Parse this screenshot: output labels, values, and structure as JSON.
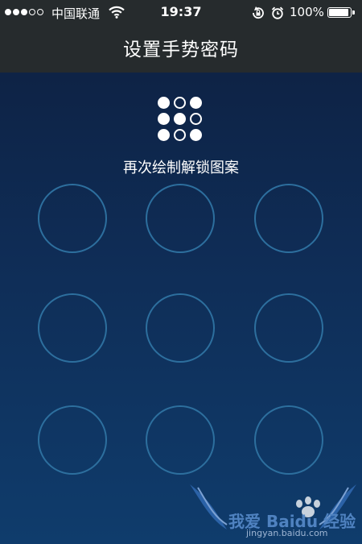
{
  "status_bar": {
    "signal_bars_filled": 3,
    "signal_bars_total": 5,
    "carrier": "中国联通",
    "time": "19:37",
    "battery_text": "100%",
    "battery_level": 1.0
  },
  "nav": {
    "title": "设置手势密码"
  },
  "pattern_preview": {
    "grid": [
      [
        true,
        false,
        true
      ],
      [
        true,
        true,
        false
      ],
      [
        true,
        false,
        true
      ]
    ]
  },
  "instruction": "再次绘制解锁图案",
  "pattern_grid": {
    "rows": 3,
    "cols": 3,
    "node_color": "#2d6f9e"
  },
  "watermark": {
    "text": "我爱 Baidu 经验",
    "url": "jingyan.baidu.com"
  },
  "colors": {
    "header_bg": "#262b2d",
    "bg_top": "#0d1f3f",
    "bg_bottom": "#0f3c6c"
  }
}
